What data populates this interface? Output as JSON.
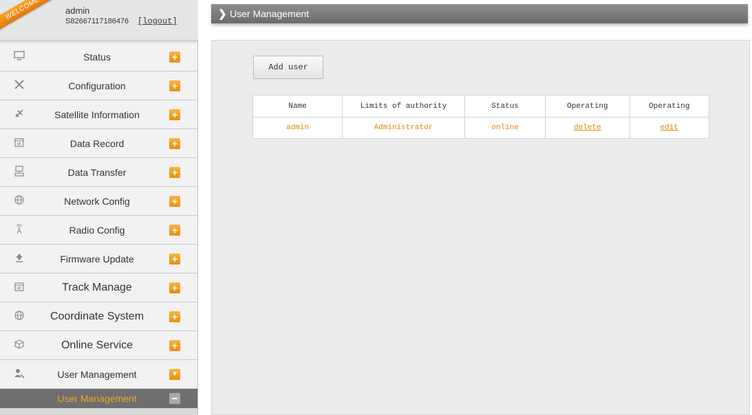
{
  "user": {
    "welcome": "WELCOME",
    "name": "admin",
    "serial": "S82667117186476",
    "logout": "[logout]"
  },
  "menu": [
    {
      "label": "Status",
      "icon": "monitor-icon"
    },
    {
      "label": "Configuration",
      "icon": "tools-icon"
    },
    {
      "label": "Satellite Information",
      "icon": "satellite-icon"
    },
    {
      "label": "Data Record",
      "icon": "calendar-icon"
    },
    {
      "label": "Data Transfer",
      "icon": "network-icon"
    },
    {
      "label": "Network Config",
      "icon": "globe-icon"
    },
    {
      "label": "Radio Config",
      "icon": "radio-tower-icon"
    },
    {
      "label": "Firmware Update",
      "icon": "upload-icon"
    },
    {
      "label": "Track Manage",
      "icon": "calendar-icon"
    },
    {
      "label": "Coordinate System",
      "icon": "globe-icon"
    },
    {
      "label": "Online Service",
      "icon": "cube-icon"
    },
    {
      "label": "User Management",
      "icon": "user-wrench-icon"
    }
  ],
  "submenu": {
    "label": "User Management"
  },
  "page": {
    "title": "User Management",
    "add_user": "Add user"
  },
  "table": {
    "headers": [
      "Name",
      "Limits of authority",
      "Status",
      "Operating",
      "Operating"
    ],
    "rows": [
      [
        "admin",
        "Administrator",
        "online",
        "delete",
        "edit"
      ]
    ]
  },
  "colors": {
    "accent": "#f4a32c",
    "link": "#e08a00",
    "titlebar": "#7d7d7d"
  }
}
